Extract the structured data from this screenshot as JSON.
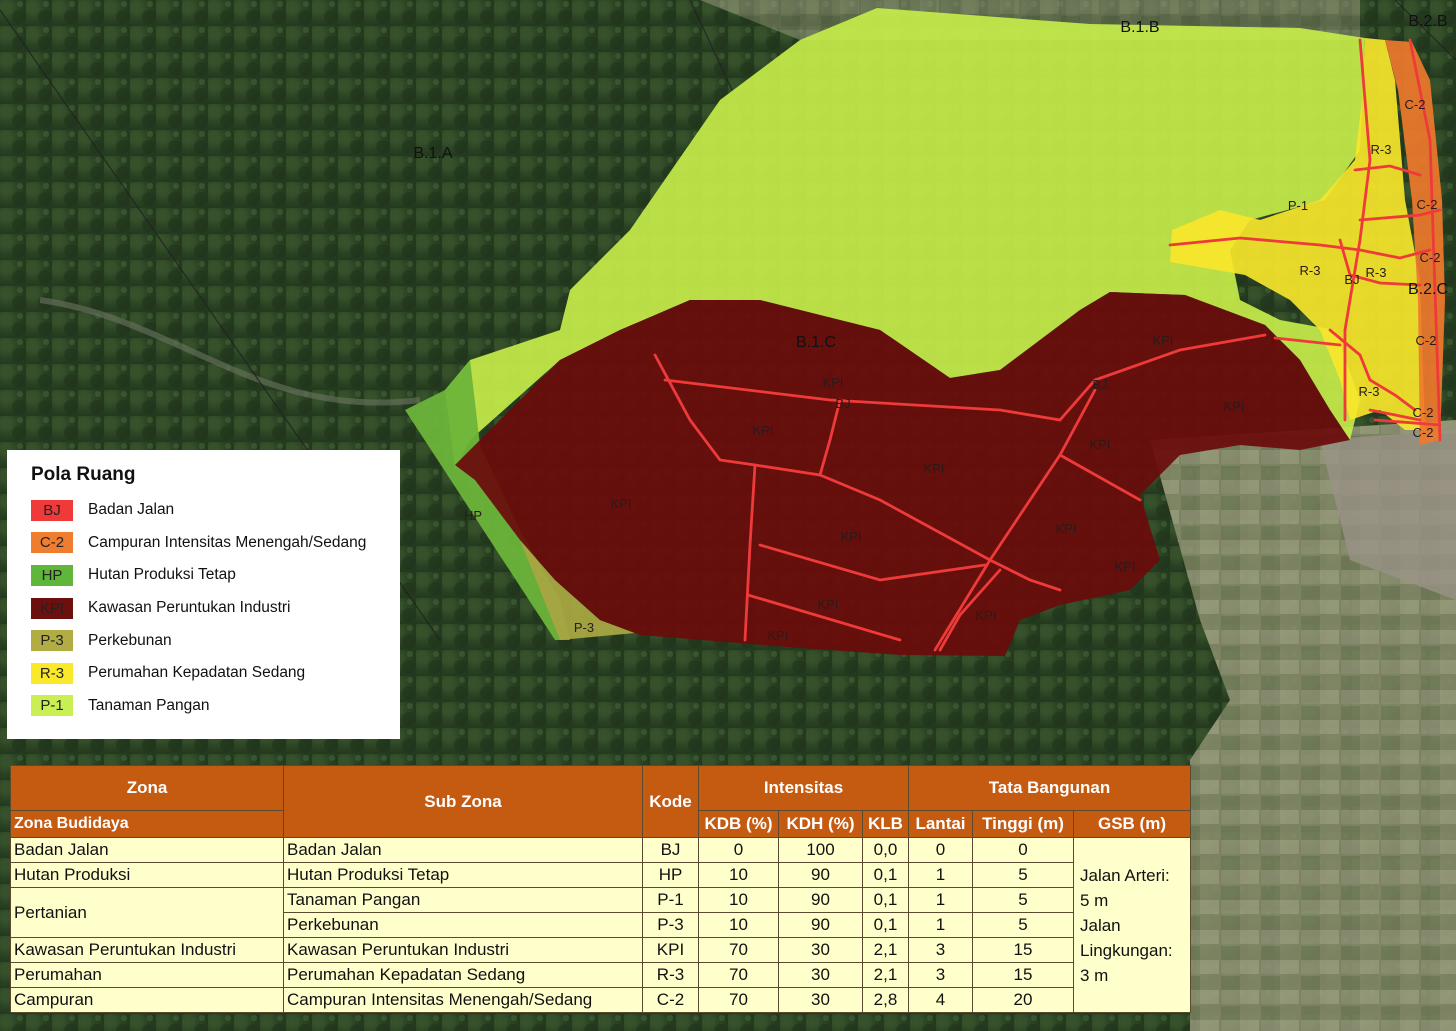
{
  "map": {
    "block_labels": [
      "B.1.A",
      "B.1.B",
      "B.1.C",
      "B.2.B",
      "B.2.C"
    ],
    "zone_labels": {
      "p1": "P-1",
      "r3": [
        "R-3",
        "R-3",
        "R-3",
        "R-3"
      ],
      "c2": [
        "C-2",
        "C-2",
        "C-2",
        "C-2",
        "C-2",
        "C-2"
      ],
      "bj": [
        "BJ",
        "BJ",
        "BJ"
      ],
      "kpi": [
        "KPI",
        "KPI",
        "KPI",
        "KPI",
        "KPI",
        "KPI",
        "KPI",
        "KPI",
        "KPI",
        "KPI",
        "KPI",
        "KPI",
        "KPI"
      ],
      "hp": "HP",
      "p3": "P-3"
    },
    "colors": {
      "p1": "#c6ec4a",
      "r3": "#f7e62b",
      "c2": "#ee7a2c",
      "kpi": "#6b0c0c",
      "hp": "#6cb43a",
      "p3": "#a7a541",
      "road": "#ef3a3a"
    }
  },
  "legend": {
    "title": "Pola Ruang",
    "items": [
      {
        "code": "BJ",
        "label": "Badan Jalan",
        "color": "#f03a3a"
      },
      {
        "code": "C-2",
        "label": "Campuran Intensitas Menengah/Sedang",
        "color": "#ef7d30"
      },
      {
        "code": "HP",
        "label": "Hutan Produksi Tetap",
        "color": "#5fb63a"
      },
      {
        "code": "KPI",
        "label": "Kawasan Peruntukan Industri",
        "color": "#6b0f0f"
      },
      {
        "code": "P-3",
        "label": "Perkebunan",
        "color": "#b1ad44"
      },
      {
        "code": "R-3",
        "label": "Perumahan Kepadatan Sedang",
        "color": "#f9e92a"
      },
      {
        "code": "P-1",
        "label": "Tanaman Pangan",
        "color": "#c9ef54"
      }
    ]
  },
  "table": {
    "headers": {
      "zona": "Zona",
      "zona_budidaya": "Zona Budidaya",
      "sub_zona": "Sub Zona",
      "kode": "Kode",
      "intensitas": "Intensitas",
      "tata_bangunan": "Tata Bangunan",
      "kdb": "KDB (%)",
      "kdh": "KDH (%)",
      "klb": "KLB",
      "lantai": "Lantai",
      "tinggi": "Tinggi (m)",
      "gsb": "GSB (m)"
    },
    "rows": [
      {
        "zona": "Badan Jalan",
        "sub": "Badan Jalan",
        "kode": "BJ",
        "kdb": "0",
        "kdh": "100",
        "klb": "0,0",
        "lantai": "0",
        "tinggi": "0"
      },
      {
        "zona": "Hutan Produksi",
        "sub": "Hutan Produksi Tetap",
        "kode": "HP",
        "kdb": "10",
        "kdh": "90",
        "klb": "0,1",
        "lantai": "1",
        "tinggi": "5"
      },
      {
        "zona": "Pertanian",
        "sub": "Tanaman Pangan",
        "kode": "P-1",
        "kdb": "10",
        "kdh": "90",
        "klb": "0,1",
        "lantai": "1",
        "tinggi": "5"
      },
      {
        "zona": "",
        "sub": "Perkebunan",
        "kode": "P-3",
        "kdb": "10",
        "kdh": "90",
        "klb": "0,1",
        "lantai": "1",
        "tinggi": "5"
      },
      {
        "zona": "Kawasan Peruntukan Industri",
        "sub": "Kawasan Peruntukan Industri",
        "kode": "KPI",
        "kdb": "70",
        "kdh": "30",
        "klb": "2,1",
        "lantai": "3",
        "tinggi": "15"
      },
      {
        "zona": "Perumahan",
        "sub": "Perumahan Kepadatan Sedang",
        "kode": "R-3",
        "kdb": "70",
        "kdh": "30",
        "klb": "2,1",
        "lantai": "3",
        "tinggi": "15"
      },
      {
        "zona": "Campuran",
        "sub": "Campuran Intensitas Menengah/Sedang",
        "kode": "C-2",
        "kdb": "70",
        "kdh": "30",
        "klb": "2,8",
        "lantai": "4",
        "tinggi": "20"
      }
    ],
    "gsb_note": [
      "Jalan Arteri:",
      "5 m",
      "Jalan",
      "Lingkungan:",
      "3 m"
    ]
  }
}
